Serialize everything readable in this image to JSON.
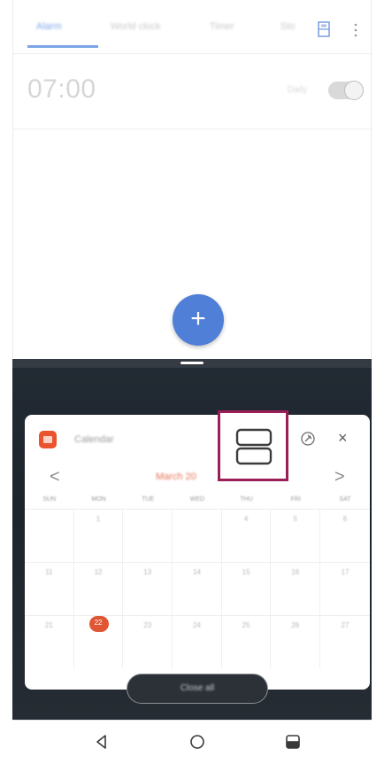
{
  "clock": {
    "tabs": [
      {
        "label": "Alarm",
        "active": true
      },
      {
        "label": "World clock",
        "active": false
      },
      {
        "label": "Timer",
        "active": false
      },
      {
        "label": "Sto",
        "active": false
      }
    ],
    "tab_icon": "hourglass-icon",
    "menu_icon": "more-vert-icon",
    "alarm": {
      "time": "07:00",
      "days": "Daily",
      "enabled": false
    },
    "fab_label": "+"
  },
  "split": {
    "handle_icon": "drag-handle-icon"
  },
  "calendar_window": {
    "app_name": "Calendar",
    "app_icon": "calendar-app-icon",
    "split_view_icon": "split-screen-icon",
    "pin_icon": "pin-icon",
    "close_label": "×",
    "prev_label": "<",
    "next_label": ">",
    "month": "March 20",
    "weekdays": [
      "SUN",
      "MON",
      "TUE",
      "WED",
      "THU",
      "FRI",
      "SAT"
    ],
    "weeks": [
      [
        "",
        "1",
        "",
        "",
        "4",
        "5",
        "6"
      ],
      [
        "11",
        "12",
        "13",
        "14",
        "15",
        "16",
        "17"
      ],
      [
        "21",
        "22",
        "23",
        "24",
        "25",
        "26",
        "27"
      ]
    ],
    "today": "22",
    "highlight_color": "#9a1f58",
    "accent_color": "#e05533"
  },
  "bottom_button": {
    "label": "Close all"
  },
  "navbar": {
    "back_icon": "back-icon",
    "home_icon": "home-icon",
    "recents_icon": "split-screen-nav-icon"
  }
}
